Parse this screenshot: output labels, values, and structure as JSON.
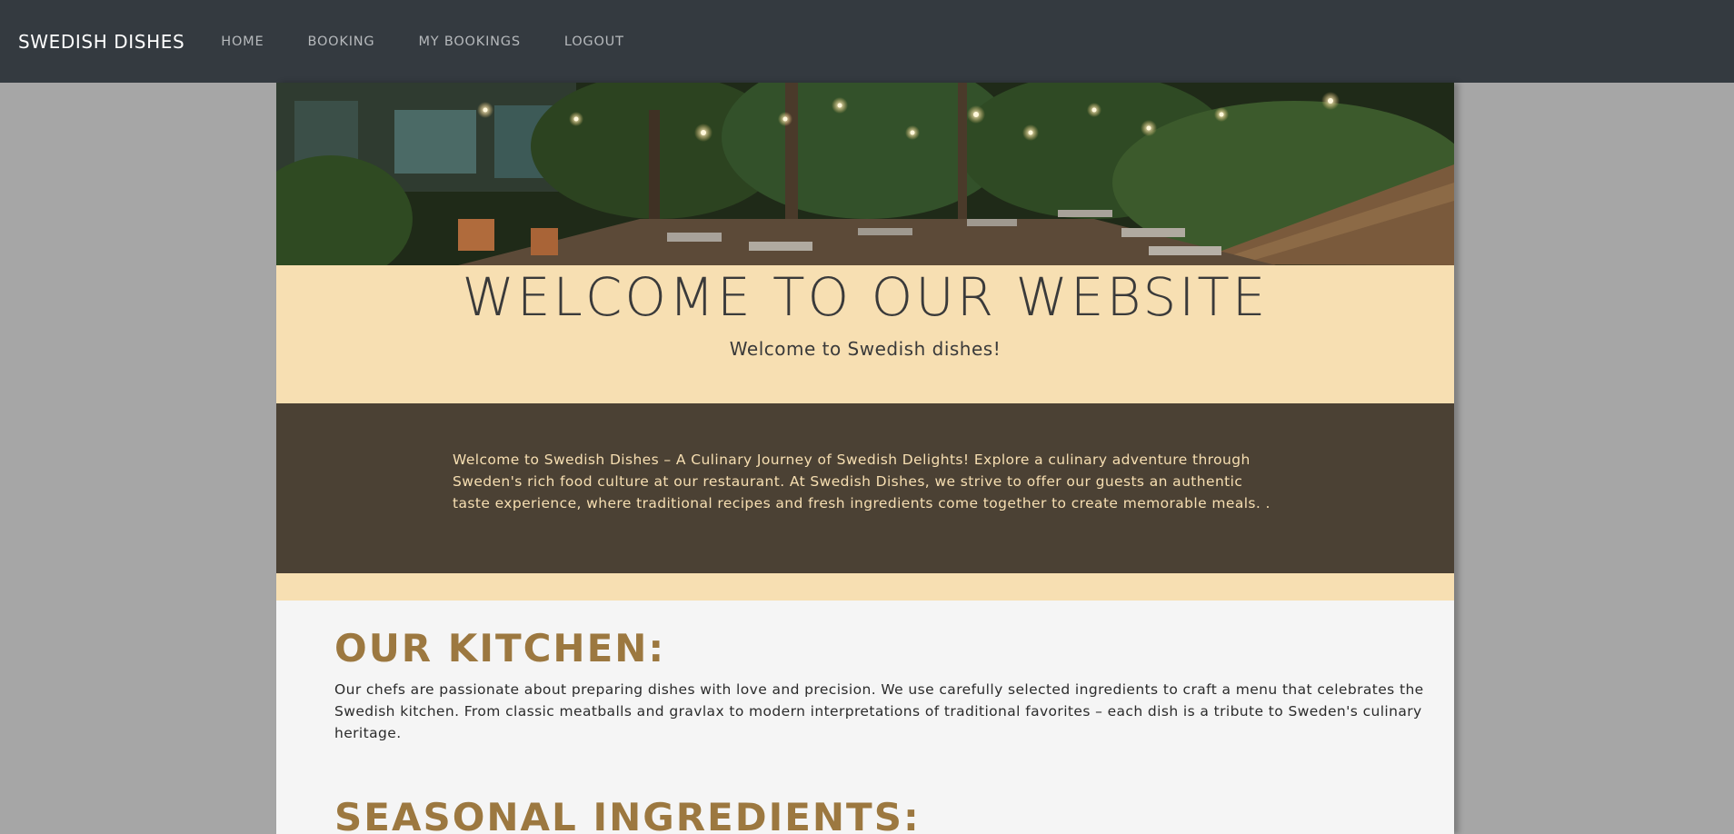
{
  "navbar": {
    "brand": "SWEDISH DISHES",
    "links": [
      "HOME",
      "BOOKING",
      "MY BOOKINGS",
      "LOGOUT"
    ]
  },
  "welcome": {
    "title": "WELCOME TO OUR WEBSITE",
    "subtitle": "Welcome to Swedish dishes!"
  },
  "intro": {
    "text": "Welcome to Swedish Dishes – A Culinary Journey of Swedish Delights! Explore a culinary adventure through Sweden's rich food culture at our restaurant. At Swedish Dishes, we strive to offer our guests an authentic taste experience, where traditional recipes and fresh ingredients come together to create memorable meals. ."
  },
  "sections": [
    {
      "heading": "OUR KITCHEN:",
      "text": "Our chefs are passionate about preparing dishes with love and precision. We use carefully selected ingredients to craft a menu that celebrates the Swedish kitchen. From classic meatballs and gravlax to modern interpretations of traditional favorites – each dish is a tribute to Sweden's culinary heritage."
    },
    {
      "heading": "SEASONAL INGREDIENTS:"
    }
  ],
  "colors": {
    "navbar_bg": "#343a40",
    "cream": "#f7dfb2",
    "dark_brown": "#4b4134",
    "heading_gold": "#9c7840",
    "page_bg": "#a6a6a6"
  }
}
